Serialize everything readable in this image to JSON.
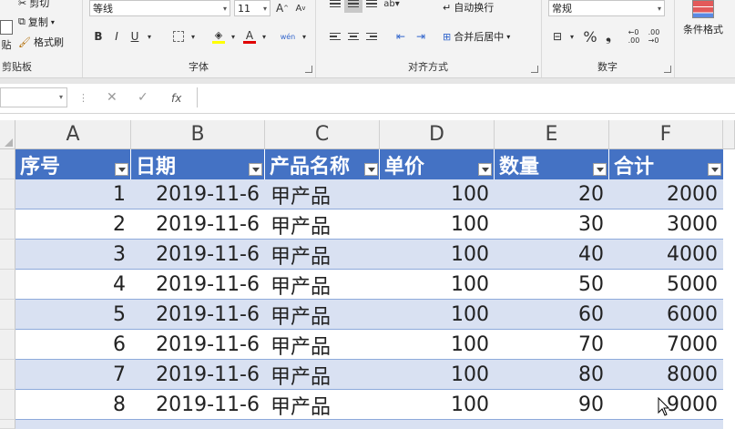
{
  "ribbon": {
    "clipboard": {
      "cut": "剪切",
      "copy": "复制",
      "format_painter": "格式刷",
      "paste": "贴",
      "label": "剪贴板"
    },
    "font": {
      "name": "等线",
      "size": "11",
      "bold": "B",
      "italic": "I",
      "underline": "U",
      "font_color": "A",
      "wen": "wén",
      "label": "字体"
    },
    "alignment": {
      "wrap": "自动换行",
      "merge": "合并后居中",
      "label": "对齐方式"
    },
    "number": {
      "format": "常规",
      "percent": "%",
      "comma": "❟",
      "label": "数字"
    },
    "styles": {
      "conditional": "条件格式"
    }
  },
  "formula_bar": {
    "namebox": "",
    "fx": "fx",
    "cancel": "✕",
    "enter": "✓"
  },
  "columns": [
    "A",
    "B",
    "C",
    "D",
    "E",
    "F"
  ],
  "headers": [
    "序号",
    "日期",
    "产品名称",
    "单价",
    "数量",
    "合计"
  ],
  "rows": [
    [
      "1",
      "2019-11-6",
      "甲产品",
      "100",
      "20",
      "2000"
    ],
    [
      "2",
      "2019-11-6",
      "甲产品",
      "100",
      "30",
      "3000"
    ],
    [
      "3",
      "2019-11-6",
      "甲产品",
      "100",
      "40",
      "4000"
    ],
    [
      "4",
      "2019-11-6",
      "甲产品",
      "100",
      "50",
      "5000"
    ],
    [
      "5",
      "2019-11-6",
      "甲产品",
      "100",
      "60",
      "6000"
    ],
    [
      "6",
      "2019-11-6",
      "甲产品",
      "100",
      "70",
      "7000"
    ],
    [
      "7",
      "2019-11-6",
      "甲产品",
      "100",
      "80",
      "8000"
    ],
    [
      "8",
      "2019-11-6",
      "甲产品",
      "100",
      "90",
      "9000"
    ]
  ],
  "colors": {
    "header": "#4472c4",
    "band": "#d9e1f2",
    "border": "#8eaadb"
  }
}
